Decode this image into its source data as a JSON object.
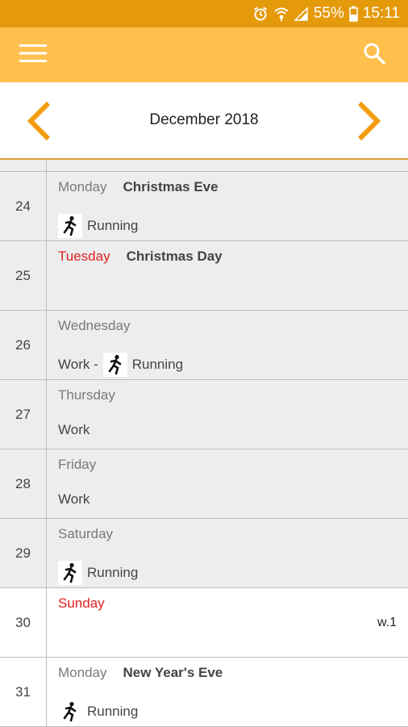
{
  "statusbar": {
    "battery": "55%",
    "time": "15:11"
  },
  "header": {
    "month_label": "December 2018"
  },
  "days": [
    {
      "date": "24",
      "day": "Monday",
      "day_color": "#7a7a7a",
      "holiday": "Christmas Eve",
      "work": "",
      "activity": "Running"
    },
    {
      "date": "25",
      "day": "Tuesday",
      "day_color": "#E02020",
      "holiday": "Christmas Day",
      "work": "",
      "activity": ""
    },
    {
      "date": "26",
      "day": "Wednesday",
      "day_color": "#7a7a7a",
      "holiday": "",
      "work": "Work -",
      "activity": "Running"
    },
    {
      "date": "27",
      "day": "Thursday",
      "day_color": "#7a7a7a",
      "holiday": "",
      "work": "Work",
      "activity": ""
    },
    {
      "date": "28",
      "day": "Friday",
      "day_color": "#7a7a7a",
      "holiday": "",
      "work": "Work",
      "activity": ""
    },
    {
      "date": "29",
      "day": "Saturday",
      "day_color": "#7a7a7a",
      "holiday": "",
      "work": "",
      "activity": "Running"
    },
    {
      "date": "30",
      "day": "Sunday",
      "day_color": "#E02020",
      "holiday": "",
      "work": "",
      "activity": "",
      "week": "w.1"
    },
    {
      "date": "31",
      "day": "Monday",
      "day_color": "#7a7a7a",
      "holiday": "New Year's Eve",
      "work": "",
      "activity": "Running"
    }
  ],
  "colors": {
    "statusbar": "#E59A0C",
    "appbar": "#FFC04D",
    "accent": "#F39C12",
    "weekend_red": "#E02020"
  },
  "icons": {
    "menu": "hamburger-icon",
    "search": "search-icon",
    "prev": "chevron-left-icon",
    "next": "chevron-right-icon",
    "activity": "running-person-icon"
  }
}
